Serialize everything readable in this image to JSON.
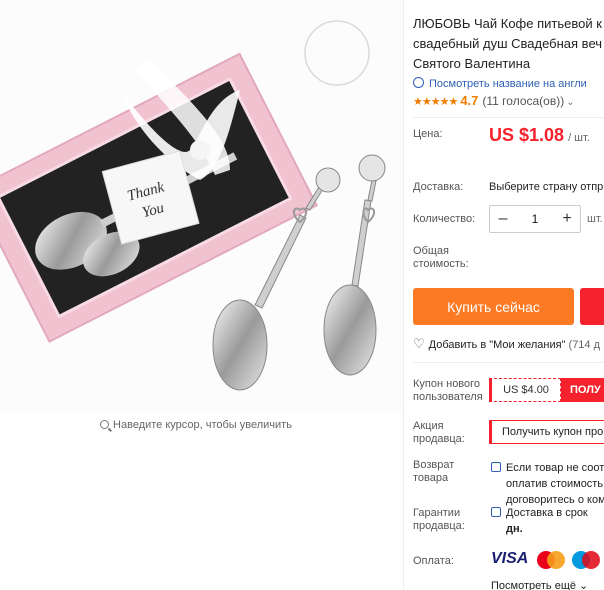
{
  "product": {
    "title_line1": "ЛЮБОВЬ Чай Кофе питьевой к",
    "title_line2": "свадебный душ Свадебная веч",
    "title_line3": "Святого Валентина",
    "translate_link": "Посмотреть название на англи",
    "rating": {
      "score": "4.7",
      "votes": "(11 голоса(ов))",
      "stars": 4.7
    },
    "price_label": "Цена:",
    "price": "US $1.08",
    "price_unit": "/ шт.",
    "delivery_label": "Доставка:",
    "delivery_value": "Выберите страну отпр",
    "quantity_label": "Количество:",
    "quantity": "1",
    "quantity_unit": "шт.",
    "total_label_1": "Общая",
    "total_label_2": "стоимость:",
    "buy_now": "Купить сейчас",
    "wishlist_label": "Добавить в \"Мои желания\"",
    "wishlist_count": "(714 д",
    "new_user_coupon_label_1": "Купон нового",
    "new_user_coupon_label_2": "пользователя",
    "new_user_coupon_amount": "US $4.00",
    "new_user_coupon_button": "ПОЛУ",
    "seller_promo_label_1": "Акция",
    "seller_promo_label_2": "продавца:",
    "seller_promo_button": "Получить купон про",
    "returns_label_1": "Возврат",
    "returns_label_2": "товара",
    "returns_text_1": "Если товар не соотв",
    "returns_text_2": "оплатив стоимость",
    "returns_text_3": "договоритесь о ком",
    "guarantee_label_1": "Гарантии",
    "guarantee_label_2": "продавца:",
    "guarantee_text_1": "Доставка в срок",
    "guarantee_text_2": "дн.",
    "payment_label": "Оплата:",
    "payment_visa": "VISA",
    "payment_mastercard": "MasterCard",
    "payment_maestro": "Maestro",
    "see_more": "Посмотреть ещё"
  },
  "gallery": {
    "zoom_hint": "Наведите курсор, чтобы увеличить",
    "card_text_1": "Thank",
    "card_text_2": "You"
  },
  "colors": {
    "accent_orange": "#fd7a24",
    "price_red": "#f5222d",
    "link_blue": "#2e5fb3",
    "box_pink": "#f3c6d3"
  }
}
